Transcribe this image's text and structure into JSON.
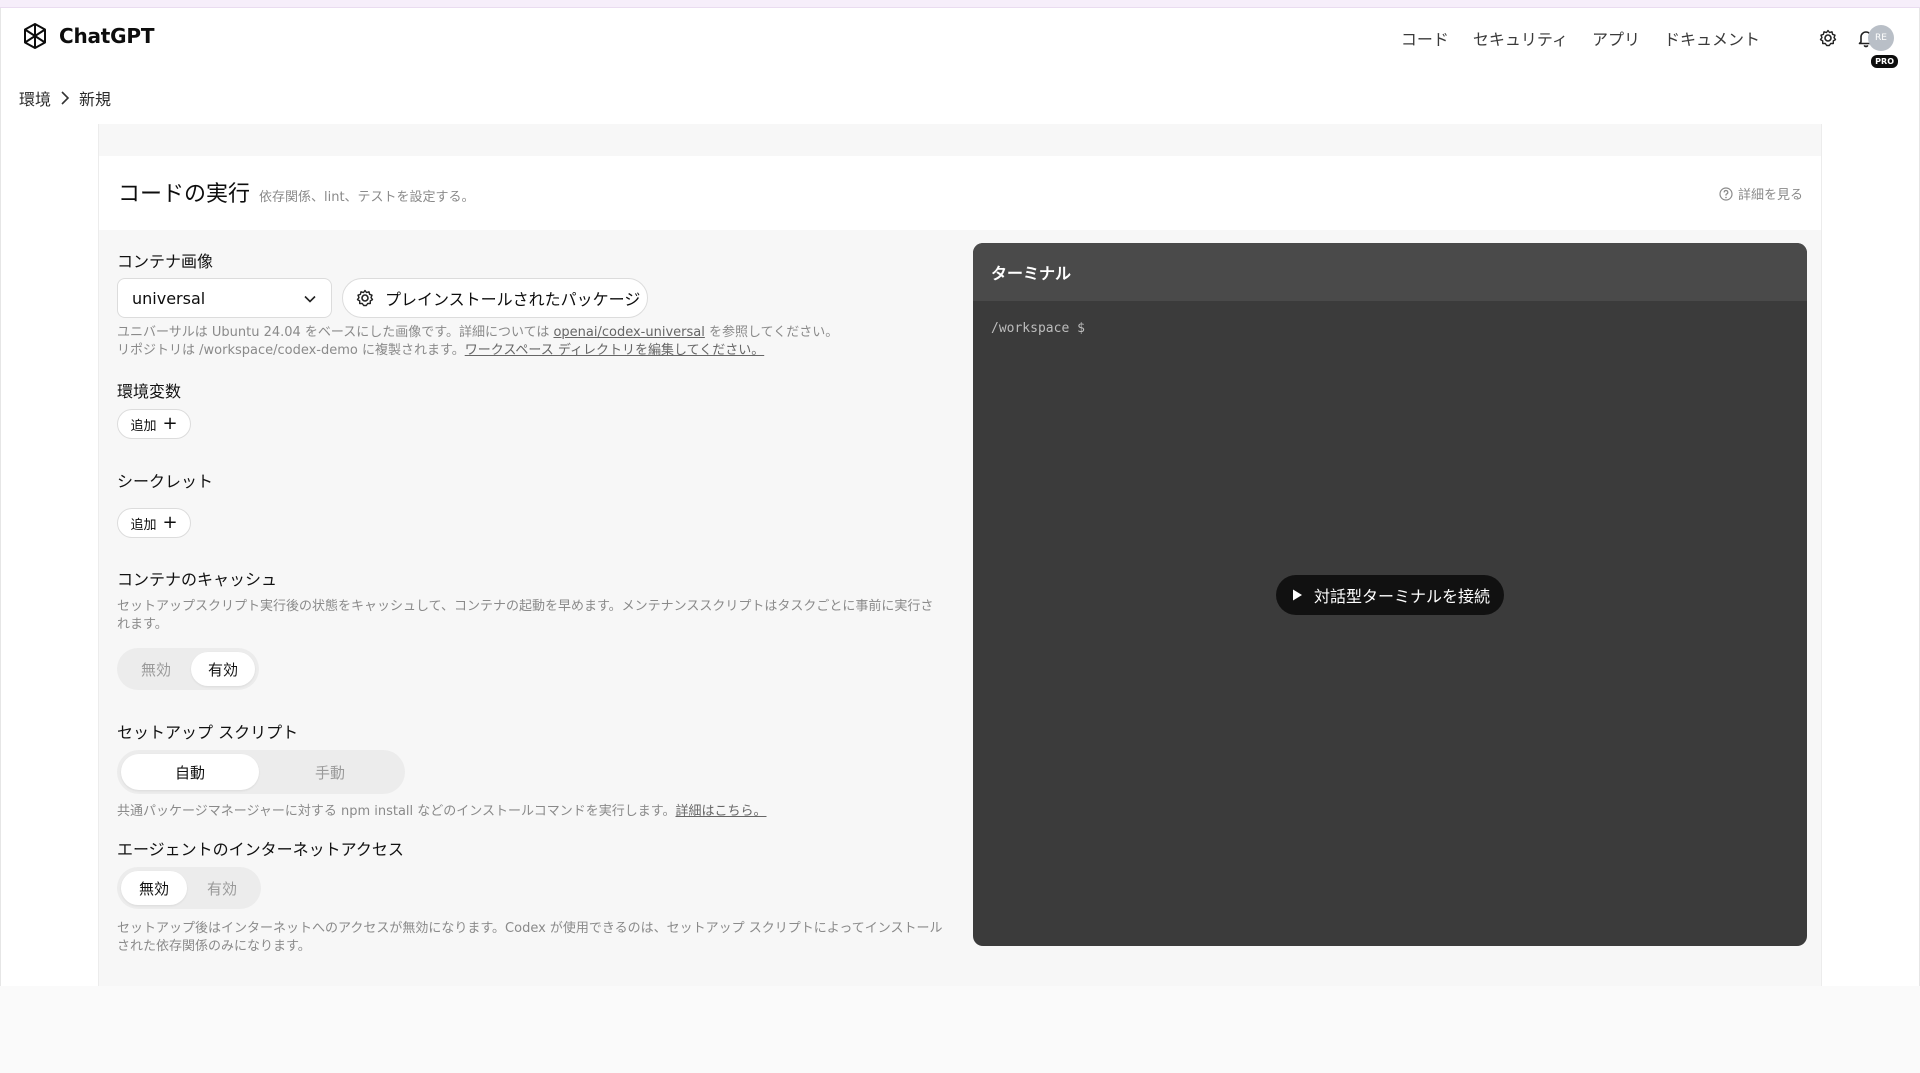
{
  "app": {
    "name": "ChatGPT"
  },
  "nav": [
    "コード",
    "セキュリティ",
    "アプリ",
    "ドキュメント"
  ],
  "user": {
    "initials": "RE",
    "plan": "PRO"
  },
  "breadcrumb": [
    "環境",
    "新規"
  ],
  "section": {
    "title": "コードの実行",
    "subtitle": "依存関係、lint、テストを設定する。",
    "help_link": "詳細を見る"
  },
  "container": {
    "label": "コンテナ画像",
    "selected": "universal",
    "packages_button": "プレインストールされたパッケージ",
    "help_line1_prefix": "ユニバーサルは Ubuntu 24.04 をベースにした画像です。詳細については ",
    "help_line1_link": "openai/codex-universal",
    "help_line1_suffix": " を参照してください。",
    "help_line2_prefix": "リポジトリは /workspace/codex-demo に複製されます。",
    "help_line2_link": "ワークスペース ディレクトリを編集してください。"
  },
  "env_vars": {
    "label": "環境変数",
    "add": "追加"
  },
  "secrets": {
    "label": "シークレット",
    "add": "追加"
  },
  "cache": {
    "label": "コンテナのキャッシュ",
    "help": "セットアップスクリプト実行後の状態をキャッシュして、コンテナの起動を早めます。メンテナンススクリプトはタスクごとに事前に実行されます。",
    "options": [
      "無効",
      "有効"
    ],
    "selected": "有効"
  },
  "setup": {
    "label": "セットアップ スクリプト",
    "options": [
      "自動",
      "手動"
    ],
    "selected": "自動",
    "help_prefix": "共通パッケージマネージャーに対する npm install などのインストールコマンドを実行します。",
    "help_link": "詳細はこちら。"
  },
  "internet": {
    "label": "エージェントのインターネットアクセス",
    "options": [
      "無効",
      "有効"
    ],
    "selected": "無効",
    "help": "セットアップ後はインターネットへのアクセスが無効になります。Codex が使用できるのは、セットアップ スクリプトによってインストールされた依存関係のみになります。"
  },
  "terminal": {
    "title": "ターミナル",
    "prompt": "/workspace $",
    "connect": "対話型ターミナルを接続"
  }
}
